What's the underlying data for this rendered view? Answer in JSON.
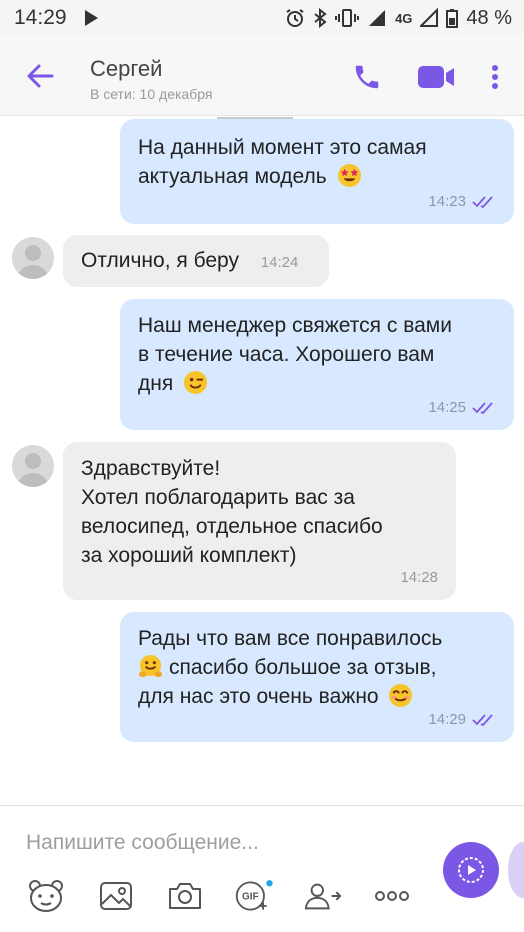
{
  "status_bar": {
    "time": "14:29",
    "network": "4G",
    "battery": "48 %"
  },
  "header": {
    "contact_name": "Сергей",
    "contact_status": "В сети: 10 декабря"
  },
  "messages": [
    {
      "direction": "out",
      "lines": [
        "На данный момент это самая",
        "актуальная модель"
      ],
      "emoji": "star-struck",
      "time": "14:23",
      "read": true
    },
    {
      "direction": "in",
      "lines": [
        "Отлично, я беру"
      ],
      "time": "14:24"
    },
    {
      "direction": "out",
      "lines": [
        "Наш менеджер свяжется с вами",
        "в течение часа. Хорошего вам",
        "дня"
      ],
      "emoji": "wink",
      "time": "14:25",
      "read": true
    },
    {
      "direction": "in",
      "lines": [
        "Здравствуйте!",
        "Хотел поблагодарить вас за",
        "велосипед, отдельное спасибо",
        "за хороший комплект)"
      ],
      "time": "14:28"
    },
    {
      "direction": "out",
      "lines": [
        "Рады что вам все понравилось",
        "спасибо большое за отзыв,",
        "для нас это очень важно"
      ],
      "emoji": "hugging, smiling",
      "time": "14:29",
      "read": true
    }
  ],
  "composer": {
    "placeholder": "Напишите сообщение..."
  },
  "toolbar_icons": [
    "sticker-icon",
    "gallery-icon",
    "camera-icon",
    "gif-icon",
    "share-contact-icon",
    "more-icon"
  ],
  "colors": {
    "accent": "#7b57e6",
    "outgoing_bubble": "#d8e9ff",
    "incoming_bubble": "#eeeeee"
  }
}
